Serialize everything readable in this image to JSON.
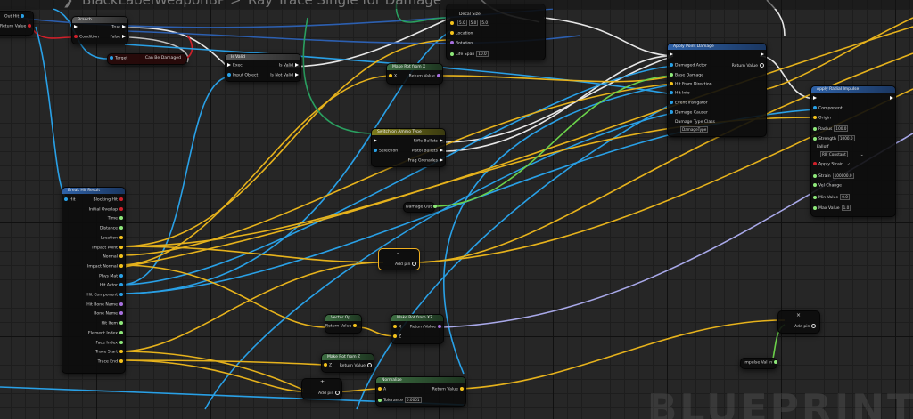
{
  "title": {
    "blueprint_name": "BlackLabelWeaponBP",
    "separator": ">",
    "graph_name": "Ray Trace Single for Damage"
  },
  "watermark": "BLUEPRINT",
  "colors": {
    "exec": "#ffffff",
    "object": "#29a0e6",
    "struct_vector": "#f4c21c",
    "float": "#8ee87a",
    "bool": "#d0202a",
    "name": "#a870e0"
  },
  "nodes": {
    "left_return": {
      "out_hit": "Out Hit",
      "return_value": "Return Value"
    },
    "branch": {
      "title": "Branch",
      "condition": "Condition",
      "true": "True",
      "false": "False"
    },
    "can_be_damaged": {
      "target": "Target",
      "label": "Can Be Damaged"
    },
    "is_valid": {
      "title": "Is Valid",
      "exec": "Exec",
      "input_object": "Input Object",
      "is_valid": "Is Valid",
      "is_not_valid": "Is Not Valid"
    },
    "decal": {
      "decal_size": "Decal Size",
      "decal_x": "5.0",
      "decal_y": "5.0",
      "decal_z": "5.0",
      "location": "Location",
      "rotation": "Rotation",
      "life_span": "Life Span",
      "life_span_value": "10.0"
    },
    "make_rot_x": {
      "title": "Make Rot from X",
      "x": "X",
      "return_value": "Return Value"
    },
    "apply_point_damage": {
      "title": "Apply Point Damage",
      "damaged_actor": "Damaged Actor",
      "base_damage": "Base Damage",
      "hit_from_direction": "Hit From Direction",
      "hit_info": "Hit Info",
      "event_instigator": "Event Instigator",
      "damage_causer": "Damage Causer",
      "damage_type_class": "Damage Type Class",
      "damage_type_value": "DamageType",
      "return_value": "Return Value"
    },
    "apply_radial_impulse": {
      "title": "Apply Radial Impulse",
      "component": "Component",
      "origin": "Origin",
      "radius": "Radius",
      "radius_value": "100.0",
      "strength": "Strength",
      "strength_value": "1000.0",
      "falloff": "Falloff",
      "falloff_value": "RIF Constant",
      "apply_strain": "Apply Strain",
      "strain": "Strain",
      "strain_value": "100000.0",
      "vel_change": "Vel Change",
      "min_value": "Min Value",
      "min_value_value": "0.0",
      "max_value": "Max Value",
      "max_value_value": "1.0"
    },
    "switch_ammo": {
      "title": "Switch on Ammo Type",
      "selection": "Selection",
      "rifle_bullets": "Rifle Bullets",
      "pistol_bullets": "Pistol Bullets",
      "frag_grenades": "Frag Grenades"
    },
    "break_hit": {
      "title": "Break Hit Result",
      "hit": "Hit",
      "pins": [
        "Blocking Hit",
        "Initial Overlap",
        "Time",
        "Distance",
        "Location",
        "Impact Point",
        "Normal",
        "Impact Normal",
        "Phys Mat",
        "Hit Actor",
        "Hit Component",
        "Hit Bone Name",
        "Bone Name",
        "Hit Item",
        "Element Index",
        "Face Index",
        "Trace Start",
        "Trace End"
      ]
    },
    "damage_out": {
      "label": "Damage Out"
    },
    "add_pin_center": {
      "symbol": "-",
      "add_pin": "Add pin"
    },
    "vector_op": {
      "title": "Vector Op",
      "return_value": "Return Value"
    },
    "make_rot_xz": {
      "title": "Make Rot from XZ",
      "x": "X",
      "z": "Z",
      "return_value": "Return Value"
    },
    "make_rot_z": {
      "title": "Make Rot from Z",
      "z": "Z",
      "return_value": "Return Value"
    },
    "add_small": {
      "symbol": "+",
      "add_pin": "Add pin"
    },
    "normalize": {
      "title": "Normalize",
      "a": "A",
      "tolerance": "Tolerance",
      "tolerance_value": "0.0001",
      "return_value": "Return Value"
    },
    "multiply": {
      "symbol": "×",
      "add_pin": "Add pin"
    },
    "impulse_val": {
      "label": "Impulse Val In"
    }
  }
}
